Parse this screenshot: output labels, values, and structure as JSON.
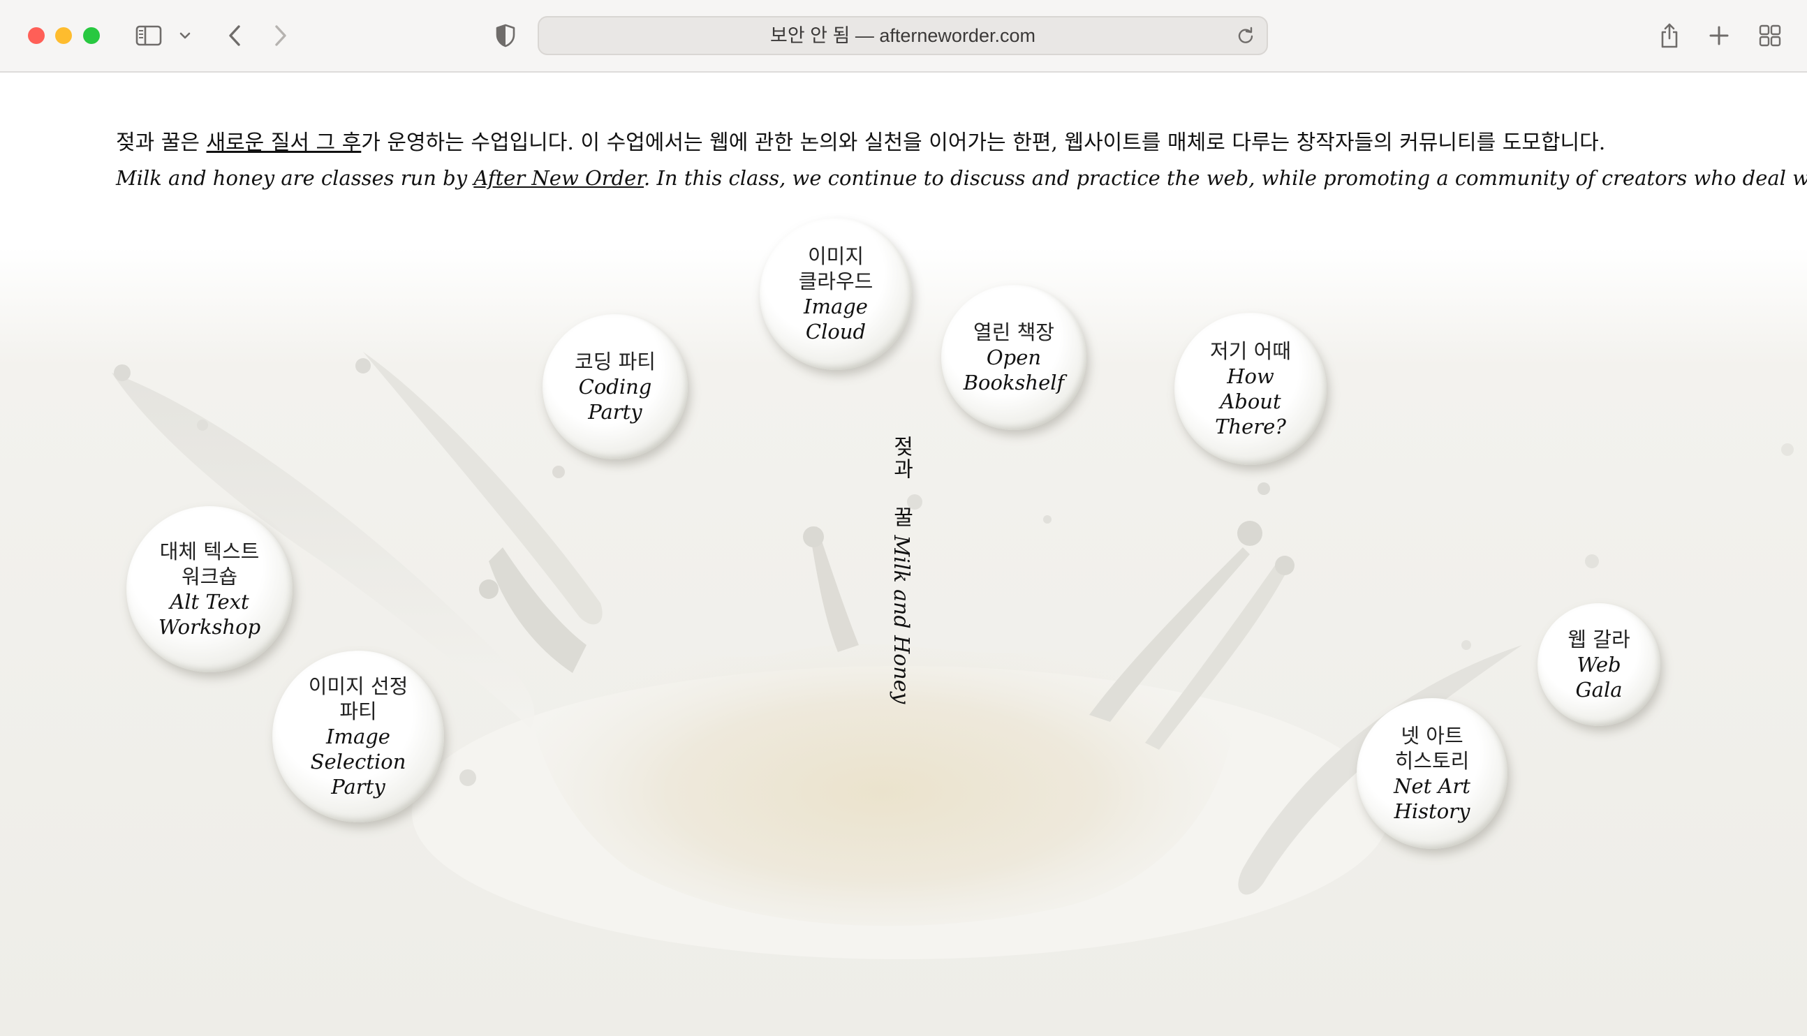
{
  "browser": {
    "address": "보안 안 됨 — afterneworder.com"
  },
  "intro": {
    "ko_before": "젖과 꿀은 ",
    "ko_link": "새로운 질서 그 후",
    "ko_after": "가 운영하는 수업입니다. 이 수업에서는 웹에 관한 논의와 실천을 이어가는 한편, 웹사이트를 매체로 다루는 창작자들의 커뮤니티를 도모합니다.",
    "en_before": "Milk and honey are classes run by ",
    "en_link": "After New Order",
    "en_after": ". In this class, we continue to discuss and practice the web, while promoting a community of creators who deal with websites as media."
  },
  "title": {
    "ko": "젖과 꿀",
    "en": "Milk and Honey"
  },
  "classes": [
    {
      "ko": "이미지\n클라우드",
      "en": "Image\nCloud"
    },
    {
      "ko": "코딩 파티",
      "en": "Coding\nParty"
    },
    {
      "ko": "열린 책장",
      "en": "Open\nBookshelf"
    },
    {
      "ko": "저기 어때",
      "en": "How\nAbout\nThere?"
    },
    {
      "ko": "대체 텍스트\n워크숍",
      "en": "Alt Text\nWorkshop"
    },
    {
      "ko": "이미지 선정\n파티",
      "en": "Image\nSelection\nParty"
    },
    {
      "ko": "웹 갈라",
      "en": "Web\nGala"
    },
    {
      "ko": "넷 아트\n히스토리",
      "en": "Net Art\nHistory"
    }
  ]
}
